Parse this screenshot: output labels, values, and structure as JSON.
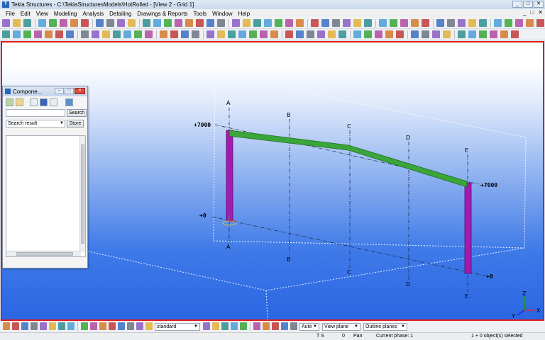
{
  "window": {
    "title": "Tekla Structures - C:\\TeklaStructuresModels\\HotRolled - [View 2 - Grid 1]",
    "buttons": [
      "_",
      "□",
      "✕"
    ]
  },
  "menu": {
    "items": [
      "File",
      "Edit",
      "View",
      "Modeling",
      "Analysis",
      "Detailing",
      "Drawings & Reports",
      "Tools",
      "Window",
      "Help"
    ],
    "right": [
      "_",
      "□",
      "✕"
    ]
  },
  "viewport": {
    "grid_labels": {
      "top": [
        "A",
        "B",
        "C",
        "D",
        "E"
      ],
      "bottom": [
        "A",
        "B",
        "C",
        "D",
        "E"
      ]
    },
    "elevations": {
      "left_top": "+7000",
      "left_bottom": "+0",
      "right_top": "+7000",
      "right_bottom": "+0"
    },
    "axis_labels": {
      "z": "Z",
      "x": "X",
      "y": "Y"
    }
  },
  "panel": {
    "title": "Compone...",
    "search_button": "Search",
    "search_value": "",
    "combo_value": "Search result",
    "store_button": "Store"
  },
  "bottom_toolbar": {
    "filter_select": "standard",
    "snap_select": "Auto",
    "plane_select": "View plane",
    "outline_select": "Outline planes"
  },
  "status": {
    "ts": "T S",
    "zero": "0",
    "mode": "Pan",
    "phase": "Current phase: 1",
    "selection": "1 + 0 object(s) selected"
  },
  "colors": {
    "accent_border": "#e01b1b",
    "beam": "#3aa63a",
    "column": "#a21bb0"
  }
}
